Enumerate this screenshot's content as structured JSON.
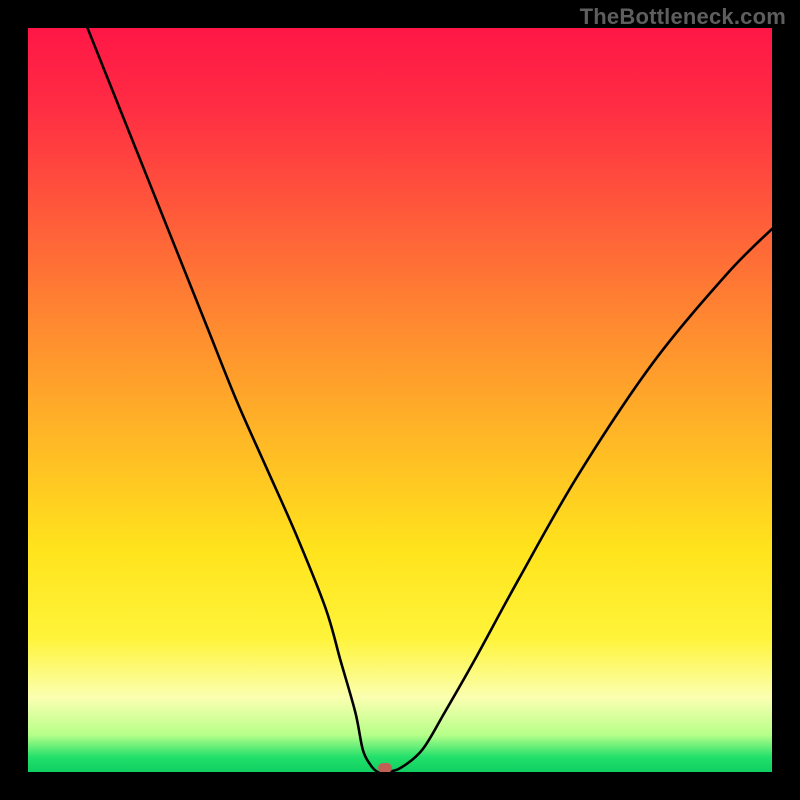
{
  "watermark": "TheBottleneck.com",
  "chart_data": {
    "type": "line",
    "title": "",
    "xlabel": "",
    "ylabel": "",
    "xlim": [
      0,
      100
    ],
    "ylim": [
      0,
      100
    ],
    "grid": false,
    "legend": false,
    "series": [
      {
        "name": "bottleneck-curve",
        "x": [
          8,
          12,
          16,
          20,
          24,
          28,
          32,
          36,
          40,
          42,
          44,
          45,
          46,
          47,
          48,
          50,
          53,
          56,
          60,
          66,
          74,
          84,
          94,
          100
        ],
        "y": [
          100,
          90,
          80,
          70,
          60,
          50,
          41,
          32,
          22,
          15,
          8,
          3,
          1,
          0,
          0,
          0.5,
          3,
          8,
          15,
          26,
          40,
          55,
          67,
          73
        ]
      }
    ],
    "annotations": [
      {
        "name": "optimal-marker",
        "x": 48,
        "y": 0.5
      }
    ],
    "background_gradient": {
      "direction": "vertical",
      "stops": [
        {
          "pos": 0.0,
          "color": "#ff1746"
        },
        {
          "pos": 0.25,
          "color": "#ff5a3a"
        },
        {
          "pos": 0.55,
          "color": "#ffb726"
        },
        {
          "pos": 0.82,
          "color": "#fff43a"
        },
        {
          "pos": 0.95,
          "color": "#b6ff8a"
        },
        {
          "pos": 1.0,
          "color": "#0fcf62"
        }
      ]
    }
  }
}
